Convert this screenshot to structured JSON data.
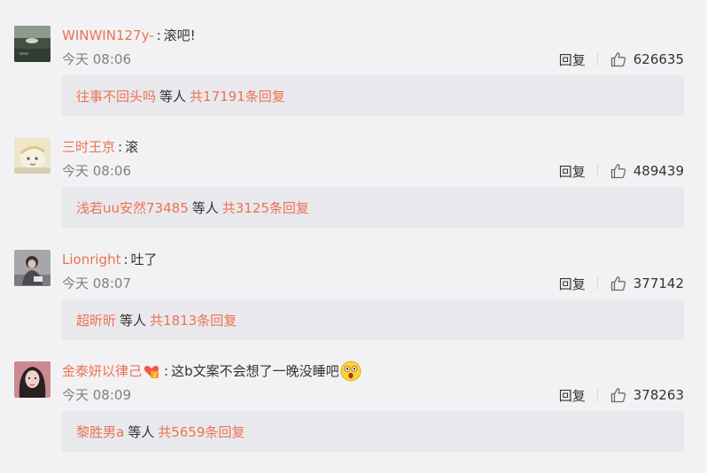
{
  "comments": [
    {
      "username": "WINWIN127y-",
      "content": "滚吧!",
      "time": "今天 08:06",
      "reply_label": "回复",
      "likes": "626635",
      "sub": {
        "user": "往事不回头吗",
        "etc": "等人",
        "total": "共17191条回复"
      },
      "avatar_icon": "landscape-avatar"
    },
    {
      "username": "三时王京",
      "content": "滚",
      "time": "今天 08:06",
      "reply_label": "回复",
      "likes": "489439",
      "sub": {
        "user": "浅若uu安然73485",
        "etc": "等人",
        "total": "共3125条回复"
      },
      "avatar_icon": "cartoon-avatar"
    },
    {
      "username": "Lionright",
      "content": "吐了",
      "time": "今天 08:07",
      "reply_label": "回复",
      "likes": "377142",
      "sub": {
        "user": "超昕昕",
        "etc": "等人",
        "total": "共1813条回复"
      },
      "avatar_icon": "person-avatar"
    },
    {
      "username": "金泰妍以律己",
      "content": "这b文案不会想了一晚没睡吧",
      "time": "今天 08:09",
      "reply_label": "回复",
      "likes": "378263",
      "sub": {
        "user": "黎胜男a",
        "etc": "等人",
        "total": "共5659条回复"
      },
      "avatar_icon": "girl-avatar",
      "badge_icon": "heart-badge-icon",
      "emoji_icon": "shocked-face-emoji"
    }
  ],
  "colors": {
    "username": "#eb7350",
    "background": "#f2f2f5",
    "reply_box": "#e9e9ed",
    "time": "#808080"
  }
}
